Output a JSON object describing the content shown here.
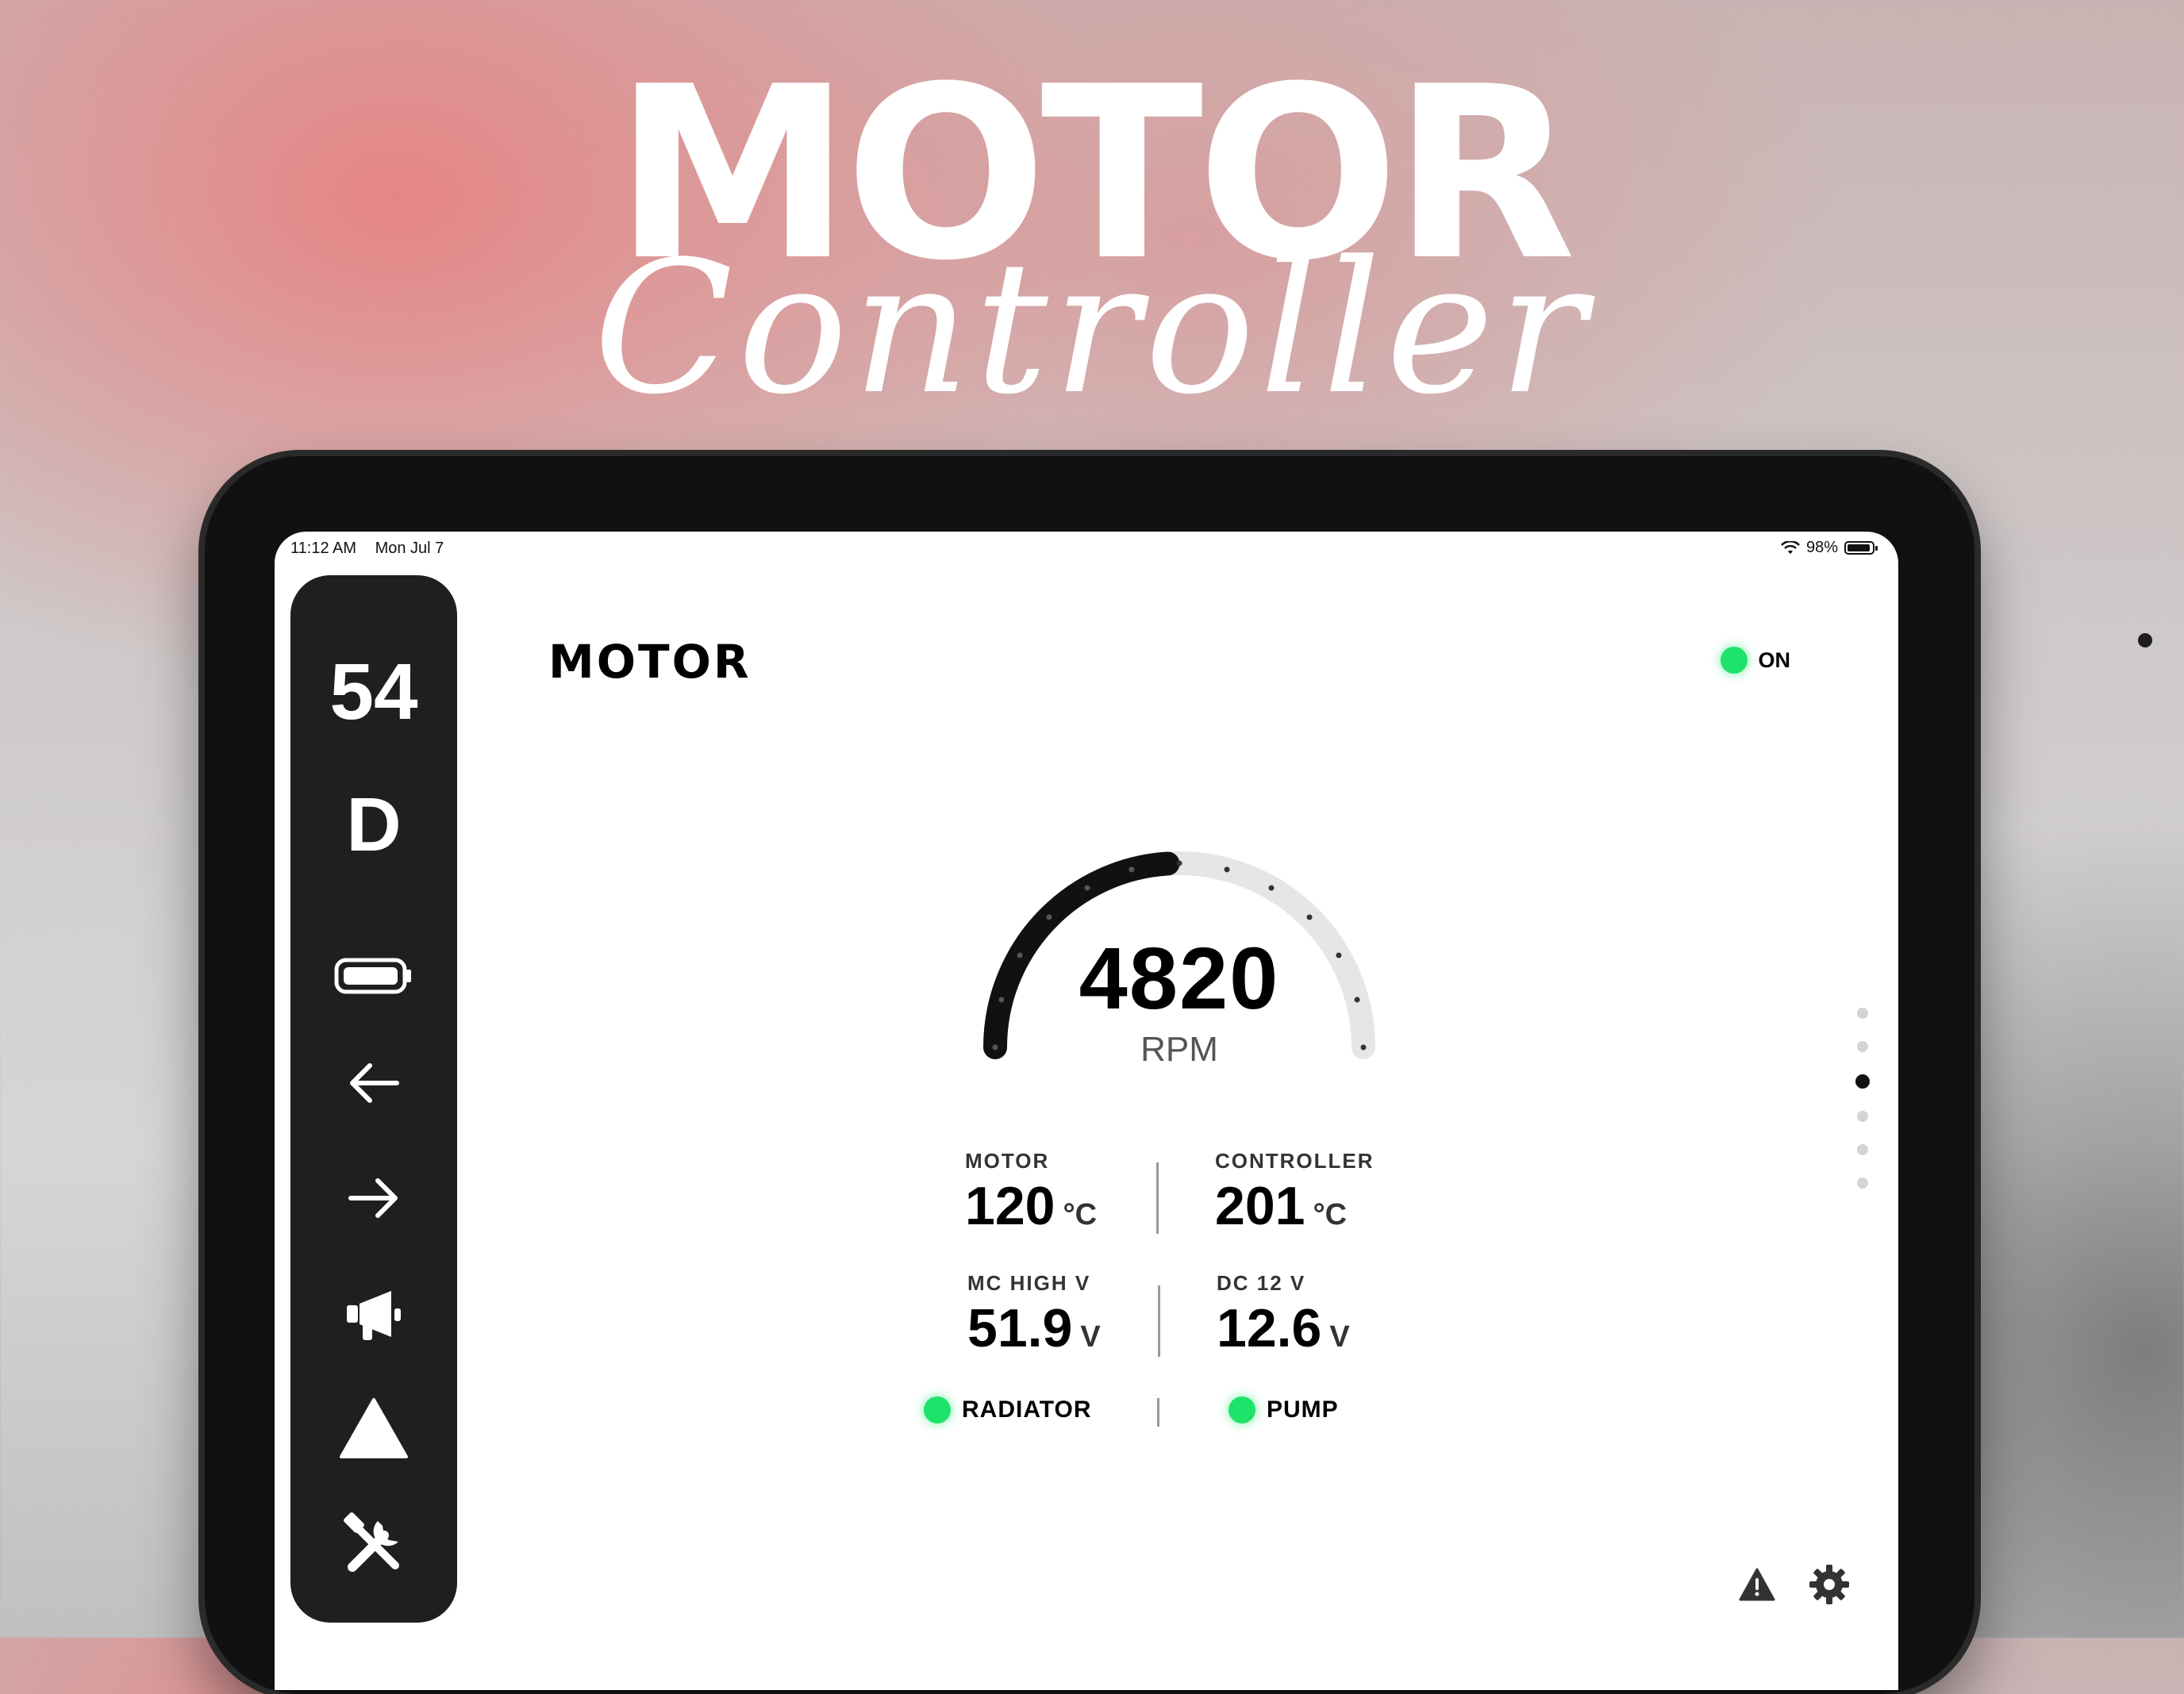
{
  "hero": {
    "title": "MOTOR",
    "script": "Controller"
  },
  "status_bar": {
    "time": "11:12 AM",
    "date": "Mon Jul 7",
    "battery": "98%"
  },
  "sidebar": {
    "speed": "54",
    "gear": "D",
    "icons": [
      "battery-icon",
      "left-turn-arrow-icon",
      "right-turn-arrow-icon",
      "horn-icon",
      "hazard-triangle-icon",
      "tools-icon"
    ]
  },
  "header": {
    "title": "MOTOR",
    "power_status": "ON"
  },
  "gauge": {
    "value": "4820",
    "unit": "RPM",
    "fill_fraction": 0.48
  },
  "metrics": {
    "motor": {
      "label": "MOTOR",
      "value": "120",
      "unit": "°C"
    },
    "controller": {
      "label": "CONTROLLER",
      "value": "201",
      "unit": "°C"
    },
    "mc_high_v": {
      "label": "MC HIGH V",
      "value": "51.9",
      "unit": "V"
    },
    "dc_12v": {
      "label": "DC 12 V",
      "value": "12.6",
      "unit": "V"
    }
  },
  "indicators": {
    "radiator": {
      "label": "RADIATOR"
    },
    "pump": {
      "label": "PUMP"
    }
  },
  "pager": {
    "count": 6,
    "active_index": 2
  },
  "colors": {
    "status_green": "#1de36b",
    "sidebar_bg": "#1f1f1f",
    "gauge_fill": "#111111",
    "gauge_track": "#e6e6e6"
  }
}
